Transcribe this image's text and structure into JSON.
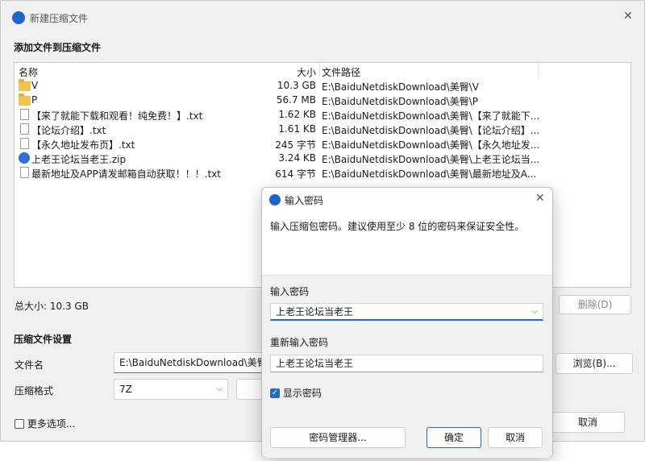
{
  "main_window": {
    "title": "新建压缩文件",
    "section_add_title": "添加文件到压缩文件",
    "columns": {
      "name": "名称",
      "size": "大小",
      "path": "文件路径"
    },
    "files": [
      {
        "icon": "folder-icon",
        "name": "V",
        "size": "10.3 GB",
        "path": "E:\\BaiduNetdiskDownload\\美臀\\V"
      },
      {
        "icon": "folder-icon",
        "name": "P",
        "size": "56.7 MB",
        "path": "E:\\BaiduNetdiskDownload\\美臀\\P"
      },
      {
        "icon": "text-file-icon",
        "name": "【来了就能下载和观看！纯免费！】.txt",
        "size": "1.62 KB",
        "path": "E:\\BaiduNetdiskDownload\\美臀\\【来了就能下..."
      },
      {
        "icon": "text-file-icon",
        "name": "【论坛介绍】.txt",
        "size": "1.61 KB",
        "path": "E:\\BaiduNetdiskDownload\\美臀\\【论坛介绍】..."
      },
      {
        "icon": "text-file-icon",
        "name": "【永久地址发布页】.txt",
        "size": "245 字节",
        "path": "E:\\BaiduNetdiskDownload\\美臀\\【永久地址发..."
      },
      {
        "icon": "zip-file-icon",
        "name": "上老王论坛当老王.zip",
        "size": "3.24 KB",
        "path": "E:\\BaiduNetdiskDownload\\美臀\\上老王论坛当..."
      },
      {
        "icon": "text-file-icon",
        "name": "最新地址及APP请发邮箱自动获取！！！.txt",
        "size": "614 字节",
        "path": "E:\\BaiduNetdiskDownload\\美臀\\最新地址及A..."
      }
    ],
    "total_size": "总大小: 10.3 GB",
    "delete_button": "删除(D)",
    "settings_title": "压缩文件设置",
    "filename_label": "文件名",
    "filename_value": "E:\\BaiduNetdiskDownload\\美臀\\",
    "browse_button": "浏览(B)...",
    "format_label": "压缩格式",
    "format_value": "7Z",
    "more_options": "更多选项...",
    "cancel_button": "取消"
  },
  "password_dialog": {
    "title": "输入密码",
    "description": "输入压缩包密码。建议使用至少 8 位的密码来保证安全性。",
    "password_label": "输入密码",
    "password_value": "上老王论坛当老王",
    "reenter_label": "重新输入密码",
    "reenter_value": "上老王论坛当老王",
    "show_password_label": "显示密码",
    "show_password_checked": true,
    "manager_button": "密码管理器...",
    "ok_button": "确定",
    "cancel_button": "取消"
  },
  "colors": {
    "accent": "#1d6cc8",
    "folder": "#f2c14e",
    "window_bg": "#f0f0f0"
  }
}
